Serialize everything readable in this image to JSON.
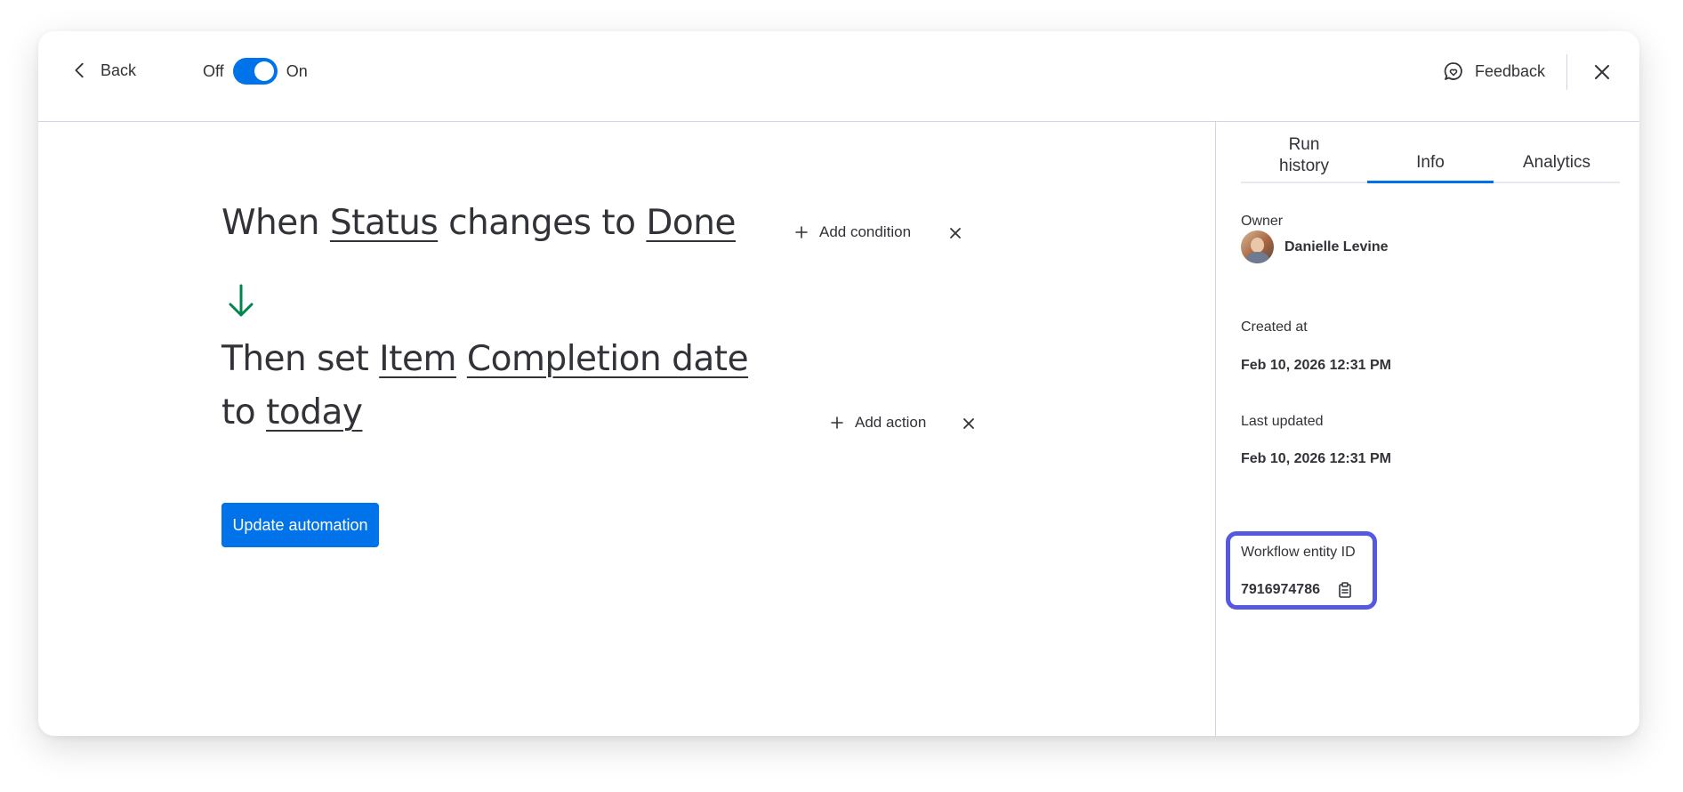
{
  "header": {
    "back_label": "Back",
    "toggle_off_label": "Off",
    "toggle_on_label": "On",
    "toggle_state": "on",
    "feedback_label": "Feedback"
  },
  "automation": {
    "trigger": {
      "prefix": "When",
      "column": "Status",
      "middle": "changes to",
      "value": "Done"
    },
    "action": {
      "prefix": "Then set",
      "target": "Item",
      "column": "Completion date",
      "connector": "to",
      "value": "today"
    },
    "add_condition_label": "Add condition",
    "add_action_label": "Add action",
    "update_button_label": "Update automation"
  },
  "sidebar": {
    "tabs": [
      {
        "label_line1": "Run",
        "label_line2": "history"
      },
      {
        "label": "Info",
        "active": true
      },
      {
        "label": "Analytics"
      }
    ],
    "owner_label": "Owner",
    "owner_name": "Danielle Levine",
    "created_label": "Created at",
    "created_value": "Feb 10, 2026 12:31 PM",
    "updated_label": "Last updated",
    "updated_value": "Feb 10, 2026 12:31 PM",
    "entity_id_label": "Workflow entity ID",
    "entity_id_value": "7916974786"
  },
  "colors": {
    "accent": "#0073ea",
    "highlight": "#5559df",
    "arrow": "#00854d"
  },
  "icons": [
    "chevron-left-icon",
    "feedback-icon",
    "close-icon",
    "plus-icon",
    "arrow-down-icon",
    "copy-icon"
  ]
}
